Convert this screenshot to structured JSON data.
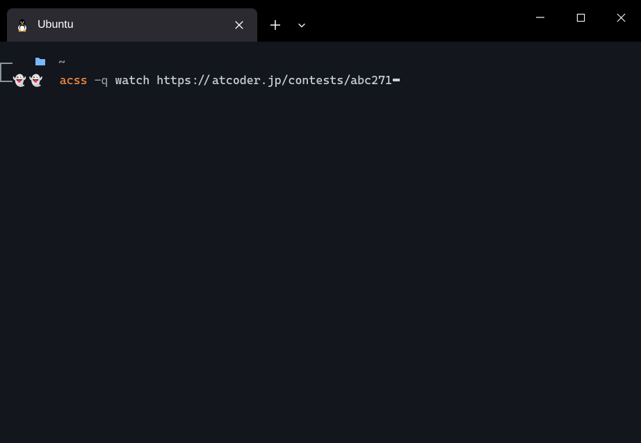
{
  "tab": {
    "title": "Ubuntu"
  },
  "prompt": {
    "path_indicator": "~",
    "ghost1": "👻",
    "ghost2": "👻"
  },
  "command": {
    "program": "acss",
    "flag": "-q",
    "subcommand": "watch",
    "argument": "https://atcoder.jp/contests/abc271"
  }
}
